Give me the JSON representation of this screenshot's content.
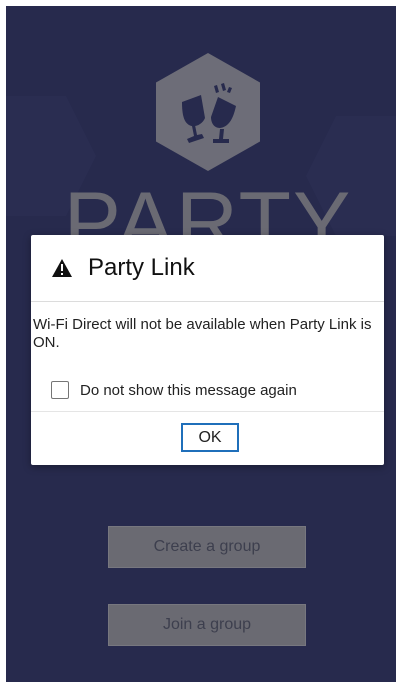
{
  "screen": {
    "background_color": "#272a4d",
    "brand_text": "PARTY"
  },
  "logo": {
    "icon": "toasting-glasses-icon",
    "color": "#6d6d78"
  },
  "buttons": {
    "create_group": "Create a group",
    "join_group": "Join a group"
  },
  "dialog": {
    "title": "Party Link",
    "title_icon": "warning-icon",
    "message": "Wi-Fi Direct will not be available when Party Link is ON.",
    "checkbox_label": "Do not show this message again",
    "checkbox_checked": false,
    "ok_button": "OK",
    "accent_color": "#1f6fba"
  }
}
